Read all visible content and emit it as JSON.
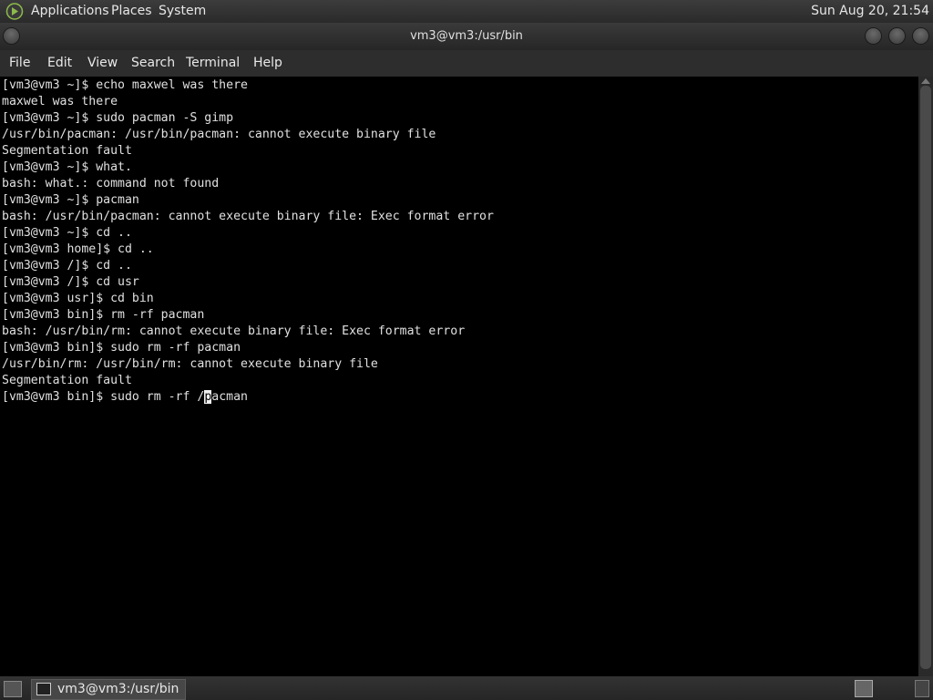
{
  "top_panel": {
    "menus": [
      "Applications",
      "Places",
      "System"
    ],
    "clock": "Sun Aug 20, 21:54"
  },
  "window": {
    "title": "vm3@vm3:/usr/bin"
  },
  "menubar": [
    "File",
    "Edit",
    "View",
    "Search",
    "Terminal",
    "Help"
  ],
  "terminal": {
    "lines": [
      "[vm3@vm3 ~]$ echo maxwel was there",
      "maxwel was there",
      "[vm3@vm3 ~]$ sudo pacman -S gimp",
      "/usr/bin/pacman: /usr/bin/pacman: cannot execute binary file",
      "Segmentation fault",
      "[vm3@vm3 ~]$ what.",
      "bash: what.: command not found",
      "[vm3@vm3 ~]$ pacman",
      "bash: /usr/bin/pacman: cannot execute binary file: Exec format error",
      "[vm3@vm3 ~]$ cd ..",
      "[vm3@vm3 home]$ cd ..",
      "[vm3@vm3 /]$ cd ..",
      "[vm3@vm3 /]$ cd usr",
      "[vm3@vm3 usr]$ cd bin",
      "[vm3@vm3 bin]$ rm -rf pacman",
      "bash: /usr/bin/rm: cannot execute binary file: Exec format error",
      "[vm3@vm3 bin]$ sudo rm -rf pacman",
      "/usr/bin/rm: /usr/bin/rm: cannot execute binary file",
      "Segmentation fault"
    ],
    "current_line_before_cursor": "[vm3@vm3 bin]$ sudo rm -rf /",
    "cursor_char": "p",
    "current_line_after_cursor": "acman"
  },
  "taskbar": {
    "task_label": "vm3@vm3:/usr/bin"
  },
  "icons": {
    "logo": "distro-logo-icon",
    "window_menu": "window-menu-icon",
    "minimize": "minimize-icon",
    "maximize": "maximize-icon",
    "close": "close-icon",
    "show_desktop": "show-desktop-icon",
    "terminal": "terminal-icon",
    "workspace": "workspace-switcher-icon",
    "trash": "trash-icon"
  }
}
